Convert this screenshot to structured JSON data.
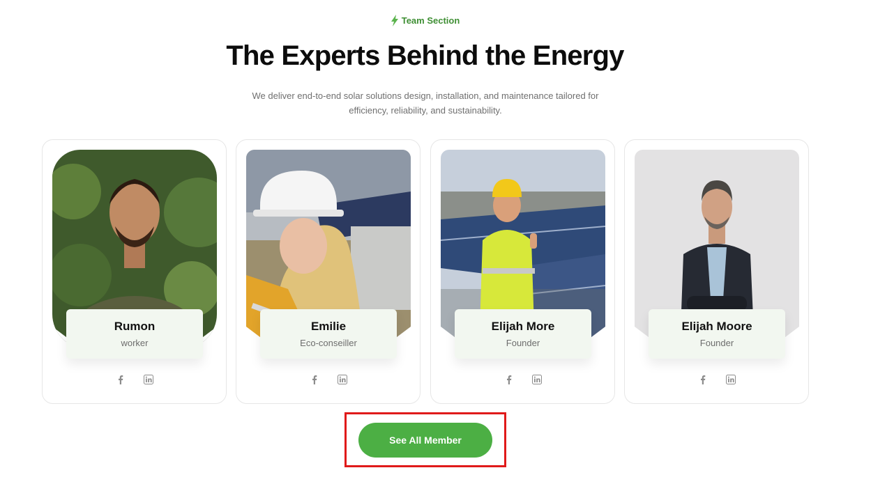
{
  "section": {
    "eyebrow_icon": "lightning-bolt-icon",
    "eyebrow": "Team Section",
    "title": "The Experts Behind the Energy",
    "subtitle": "We deliver end-to-end solar solutions design, installation, and maintenance tailored for efficiency, reliability, and sustainability."
  },
  "team": [
    {
      "name": "Rumon",
      "role": "worker",
      "photo": "man-smiling-in-greenery-photo"
    },
    {
      "name": "Emilie",
      "role": "Eco-conseiller",
      "photo": "woman-in-hard-hat-at-solar-site-photo"
    },
    {
      "name": "Elijah More",
      "role": "Founder",
      "photo": "worker-thumbs-up-by-solar-panels-photo"
    },
    {
      "name": "Elijah Moore",
      "role": "Founder",
      "photo": "man-in-suit-arms-crossed-photo"
    }
  ],
  "social_icons": [
    "facebook-icon",
    "linkedin-icon"
  ],
  "cta": {
    "label": "See All Member"
  },
  "colors": {
    "accent": "#4caf44",
    "eyebrow": "#3f8f34",
    "card_info_bg": "#f2f7f0",
    "highlight": "#e01a1a"
  }
}
